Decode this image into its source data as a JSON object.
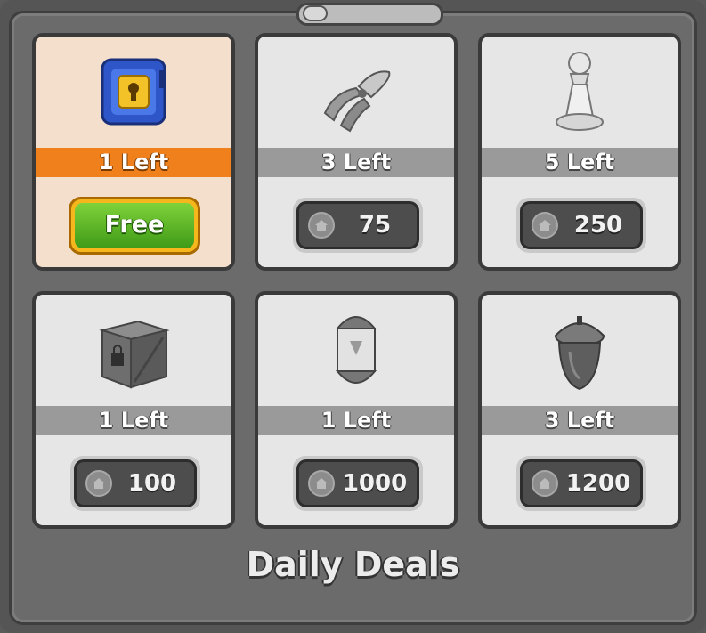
{
  "title": "Daily Deals",
  "colors": {
    "accent_orange": "#f0801c",
    "free_green": "#4aa820",
    "highlight_blue": "#1047c9"
  },
  "deals": [
    {
      "item": "safe-box-icon",
      "left": "1 Left",
      "price_label": "Free",
      "price": null,
      "active": true
    },
    {
      "item": "pliers-icon",
      "left": "3 Left",
      "price": "75",
      "active": false
    },
    {
      "item": "chess-pawn-icon",
      "left": "5 Left",
      "price": "250",
      "active": false
    },
    {
      "item": "locked-crate-icon",
      "left": "1 Left",
      "price": "100",
      "active": false
    },
    {
      "item": "capsule-icon",
      "left": "1 Left",
      "price": "1000",
      "active": false
    },
    {
      "item": "acorn-icon",
      "left": "3 Left",
      "price": "1200",
      "active": false
    }
  ]
}
